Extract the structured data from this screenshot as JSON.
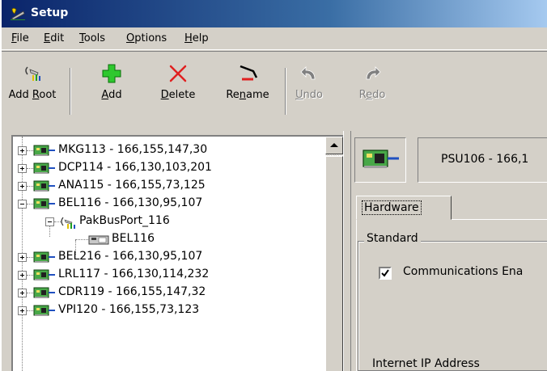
{
  "window": {
    "title": "Setup"
  },
  "menu": [
    {
      "label": "File",
      "accel": "F",
      "rest": "ile"
    },
    {
      "label": "Edit",
      "accel": "E",
      "rest": "dit"
    },
    {
      "label": "Tools",
      "accel": "T",
      "rest": "ools"
    },
    {
      "label": "Options",
      "accel": "O",
      "rest": "ptions"
    },
    {
      "label": "Help",
      "accel": "H",
      "rest": "elp"
    }
  ],
  "toolbar": {
    "add_root": {
      "pre": "Add ",
      "accel": "R",
      "post": "oot",
      "enabled": true
    },
    "add": {
      "pre": "",
      "accel": "A",
      "post": "dd",
      "enabled": true
    },
    "delete": {
      "pre": "",
      "accel": "D",
      "post": "elete",
      "enabled": true
    },
    "rename": {
      "pre": "Re",
      "accel": "n",
      "post": "ame",
      "enabled": true
    },
    "undo": {
      "pre": "",
      "accel": "U",
      "post": "ndo",
      "enabled": false
    },
    "redo": {
      "pre": "R",
      "accel": "e",
      "post": "do",
      "enabled": false
    }
  },
  "tree": {
    "nodes": [
      {
        "label": "MKG113 - 166,155,147,30",
        "level": 0,
        "icon": "datalogger-icon",
        "expanded": false
      },
      {
        "label": "DCP114 - 166,130,103,201",
        "level": 0,
        "icon": "datalogger-icon",
        "expanded": false
      },
      {
        "label": "ANA115 - 166,155,73,125",
        "level": 0,
        "icon": "datalogger-icon",
        "expanded": false
      },
      {
        "label": "BEL116 - 166,130,95,107",
        "level": 0,
        "icon": "datalogger-icon",
        "expanded": true
      },
      {
        "label": "PakBusPort_116",
        "level": 1,
        "icon": "pakbus-port-icon",
        "expanded": true
      },
      {
        "label": "BEL116",
        "level": 2,
        "icon": "cr-logger-icon"
      },
      {
        "label": "BEL216 - 166,130,95,107",
        "level": 0,
        "icon": "datalogger-icon",
        "expanded": false
      },
      {
        "label": "LRL117 - 166,130,114,232",
        "level": 0,
        "icon": "datalogger-icon",
        "expanded": false
      },
      {
        "label": "CDR119 - 166,155,147,32",
        "level": 0,
        "icon": "datalogger-icon",
        "expanded": false
      },
      {
        "label": "VPI120 - 166,155,73,123",
        "level": 0,
        "icon": "datalogger-icon",
        "expanded": false
      }
    ]
  },
  "details": {
    "device_title": "PSU106 - 166,1",
    "tab": "Hardware",
    "group": "Standard",
    "communications_enabled": {
      "label": "Communications Ena",
      "checked": true
    },
    "ip_label": "Internet IP Address"
  }
}
